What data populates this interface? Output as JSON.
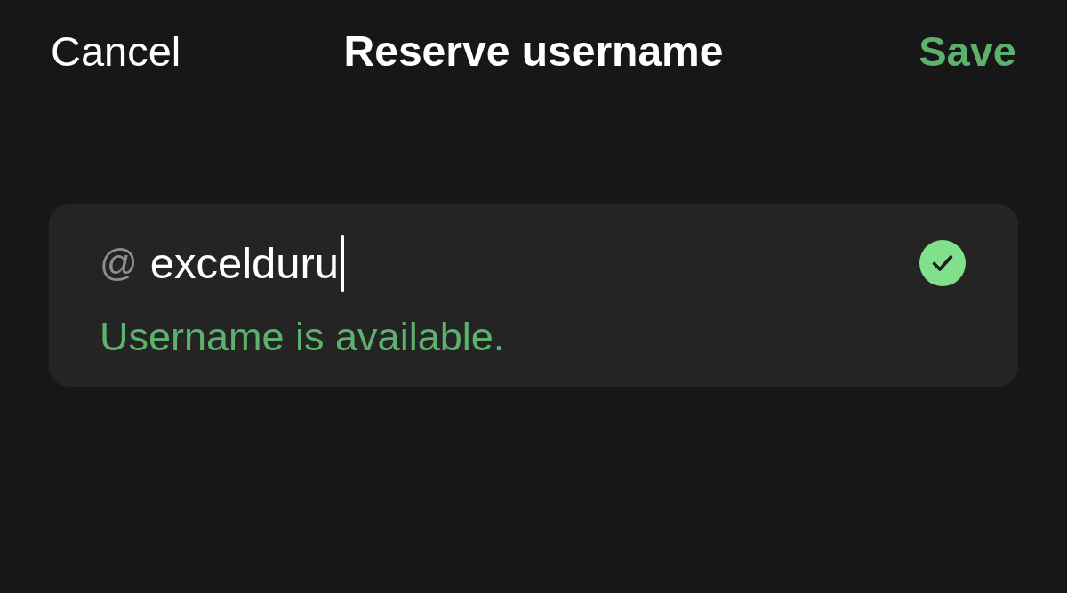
{
  "header": {
    "cancel": "Cancel",
    "title": "Reserve username",
    "save": "Save"
  },
  "username": {
    "prefix": "@",
    "value": "excelduru",
    "focused": true,
    "available": true,
    "message": "Username is available."
  }
}
